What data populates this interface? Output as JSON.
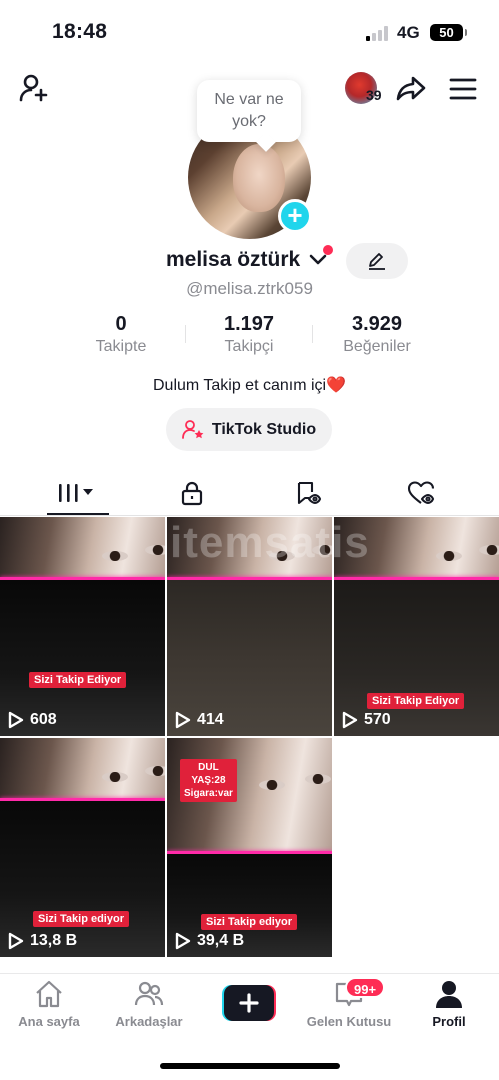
{
  "status_bar": {
    "time": "18:48",
    "network": "4G",
    "battery": "50"
  },
  "header": {
    "notification_count": "39"
  },
  "profile": {
    "bubble_text": "Ne var ne yok?",
    "name": "melisa öztürk",
    "handle": "@melisa.ztrk059",
    "bio_text": "Dulum Takip et canım içi",
    "bio_emoji": "❤️",
    "studio_label": "TikTok Studio"
  },
  "stats": [
    {
      "value": "0",
      "label": "Takipte"
    },
    {
      "value": "1.197",
      "label": "Takipçi"
    },
    {
      "value": "3.929",
      "label": "Beğeniler"
    }
  ],
  "tabs": [
    {
      "name": "videos",
      "icon": "grid-icon"
    },
    {
      "name": "private",
      "icon": "lock-icon"
    },
    {
      "name": "reposts",
      "icon": "repost-icon"
    },
    {
      "name": "liked",
      "icon": "liked-icon"
    }
  ],
  "watermark": "itemsatis",
  "videos": [
    {
      "views": "608",
      "tag": "Sizi Takip Ediyor"
    },
    {
      "views": "414",
      "tag": ""
    },
    {
      "views": "570",
      "tag": "Sizi Takip Ediyor"
    },
    {
      "views": "13,8 B",
      "tag": "Sizi Takip ediyor"
    },
    {
      "views": "39,4 B",
      "tag": "Sizi Takip ediyor",
      "note_lines": [
        "DUL",
        "YAŞ:28",
        "Sigara:var"
      ]
    }
  ],
  "bottom_nav": [
    {
      "label": "Ana sayfa",
      "icon": "home-icon"
    },
    {
      "label": "Arkadaşlar",
      "icon": "friends-icon"
    },
    {
      "label": "",
      "icon": "create-icon"
    },
    {
      "label": "Gelen Kutusu",
      "icon": "inbox-icon",
      "badge": "99+"
    },
    {
      "label": "Profil",
      "icon": "profile-icon",
      "active": true
    }
  ],
  "colors": {
    "accent": "#fe2c55",
    "cyan": "#20d5ec",
    "text": "#161823",
    "muted": "#8a8b91"
  }
}
